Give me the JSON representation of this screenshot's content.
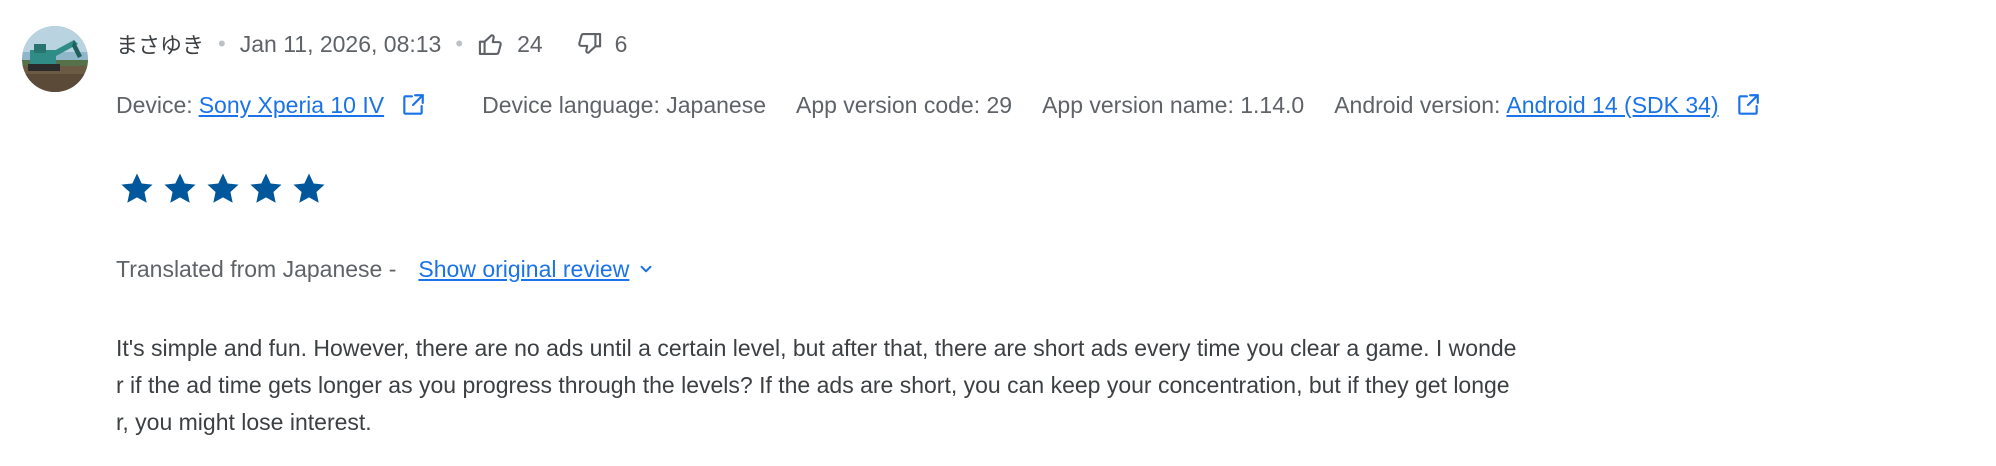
{
  "colors": {
    "link": "#1a73e8",
    "star": "#01579b",
    "muted": "#5f6368",
    "text": "#3c4043"
  },
  "review": {
    "author": "まさゆき",
    "timestamp": "Jan 11, 2026, 08:13",
    "thumbs_up": {
      "icon": "thumbs-up-icon",
      "count": "24"
    },
    "thumbs_down": {
      "icon": "thumbs-down-icon",
      "count": "6"
    },
    "rating": 5,
    "rating_max": 5
  },
  "device_info": {
    "device_label": "Device:",
    "device_value": "Sony Xperia 10 IV",
    "device_language": "Device language: Japanese",
    "app_version_code": "App version code: 29",
    "app_version_name": "App version name: 1.14.0",
    "android_label": "Android version:",
    "android_value": "Android 14 (SDK 34)",
    "open_icon": "open-in-new-icon"
  },
  "translation": {
    "label": "Translated from Japanese -",
    "show_original": "Show original review",
    "chevron": "chevron-down-icon"
  },
  "body_lines": [
    "It's simple and fun. However, there are no ads until a certain level, but after that, there are short ads every time you clear a game. I wonde",
    "r if the ad time gets longer as you progress through the levels? If the ads are short, you can keep your concentration, but if they get longe",
    "r, you might lose interest."
  ]
}
